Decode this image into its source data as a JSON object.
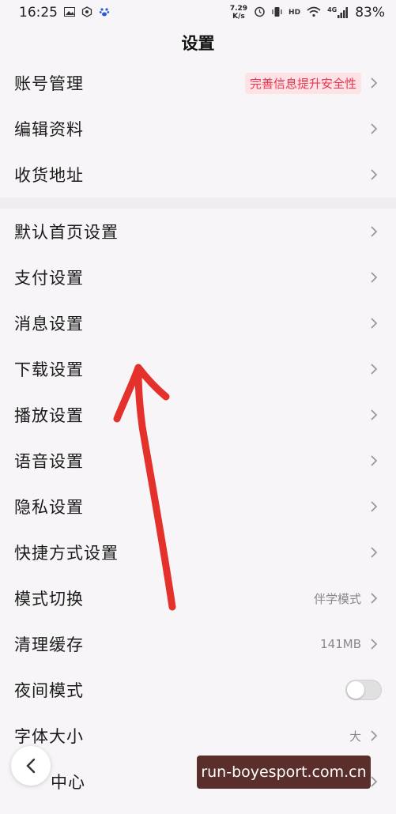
{
  "status_bar": {
    "time": "16:25",
    "net_speed_value": "7.29",
    "net_speed_unit": "K/s",
    "hd": "HD",
    "network": "4G",
    "battery": "83%"
  },
  "header": {
    "title": "设置"
  },
  "groups": [
    {
      "rows": [
        {
          "label": "账号管理",
          "badge": "完善信息提升安全性"
        },
        {
          "label": "编辑资料"
        },
        {
          "label": "收货地址"
        }
      ]
    },
    {
      "rows": [
        {
          "label": "默认首页设置"
        },
        {
          "label": "支付设置"
        },
        {
          "label": "消息设置"
        },
        {
          "label": "下载设置"
        },
        {
          "label": "播放设置"
        },
        {
          "label": "语音设置"
        },
        {
          "label": "隐私设置"
        },
        {
          "label": "快捷方式设置"
        },
        {
          "label": "模式切换",
          "value": "伴学模式"
        },
        {
          "label": "清理缓存",
          "value": "141MB"
        },
        {
          "label": "夜间模式",
          "toggle": false
        },
        {
          "label": "字体大小",
          "value": "大"
        },
        {
          "label": "中心"
        }
      ]
    }
  ],
  "watermark": "run-boyesport.com.cn",
  "colors": {
    "badge_bg": "#fde3e6",
    "badge_text": "#e8354f",
    "annotation_arrow": "#e4312b"
  }
}
